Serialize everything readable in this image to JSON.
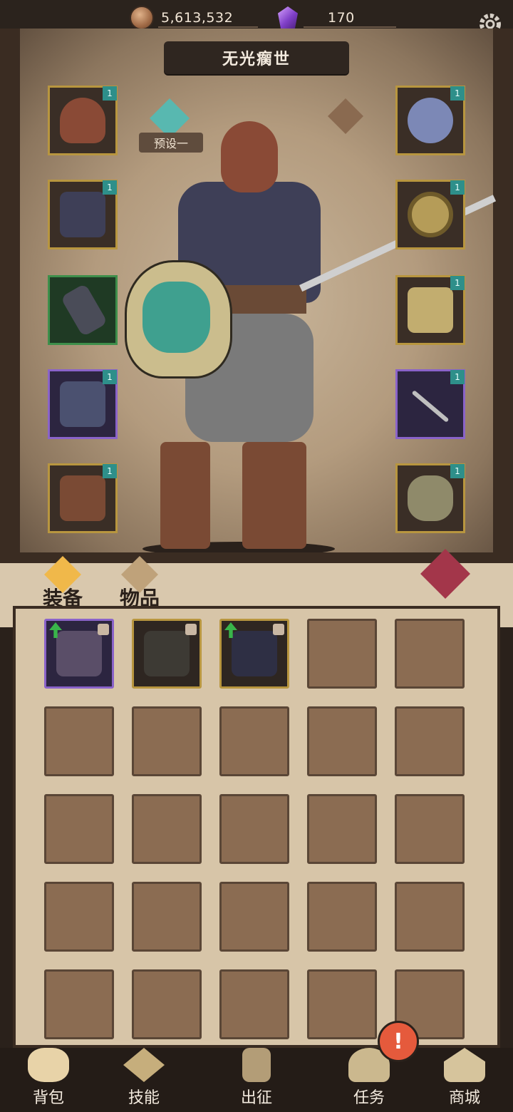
{
  "resources": {
    "coins": "5,613,532",
    "gems": "170"
  },
  "title": "无光瘸世",
  "preset": {
    "label": "预设一"
  },
  "equipment": {
    "left": [
      {
        "name": "helmet",
        "rarity": "gold",
        "level": "1"
      },
      {
        "name": "chest-armor",
        "rarity": "gold",
        "level": "1"
      },
      {
        "name": "bracers",
        "rarity": "green",
        "level": ""
      },
      {
        "name": "pants",
        "rarity": "purple",
        "level": "1"
      },
      {
        "name": "boots",
        "rarity": "gold",
        "level": "1"
      }
    ],
    "right": [
      {
        "name": "necklace",
        "rarity": "gold",
        "level": "1"
      },
      {
        "name": "ring",
        "rarity": "gold",
        "level": "1"
      },
      {
        "name": "gauntlet",
        "rarity": "gold",
        "level": "1"
      },
      {
        "name": "sword",
        "rarity": "purple",
        "level": "1"
      },
      {
        "name": "shield",
        "rarity": "gold",
        "level": "1"
      }
    ]
  },
  "tabs": {
    "equipment": "装备",
    "items": "物品"
  },
  "inventory": {
    "items": [
      {
        "name": "pants",
        "rarity": "purple",
        "upgrade": true,
        "locked": true
      },
      {
        "name": "spine-staff",
        "rarity": "gold",
        "upgrade": false,
        "locked": true
      },
      {
        "name": "dark-blade",
        "rarity": "gold",
        "upgrade": true,
        "locked": true
      }
    ],
    "total_slots": 25
  },
  "nav": [
    {
      "label": "背包",
      "icon": "backpack-icon"
    },
    {
      "label": "技能",
      "icon": "skill-book-icon"
    },
    {
      "label": "出征",
      "icon": "expedition-icon"
    },
    {
      "label": "任务",
      "icon": "quest-icon"
    },
    {
      "label": "商城",
      "icon": "shop-icon"
    }
  ],
  "quest_badge": "!",
  "colors": {
    "gold_frame": "#b8963f",
    "purple_frame": "#8a63c9",
    "green_frame": "#3e8f4b",
    "badge": "#e55a3c"
  }
}
